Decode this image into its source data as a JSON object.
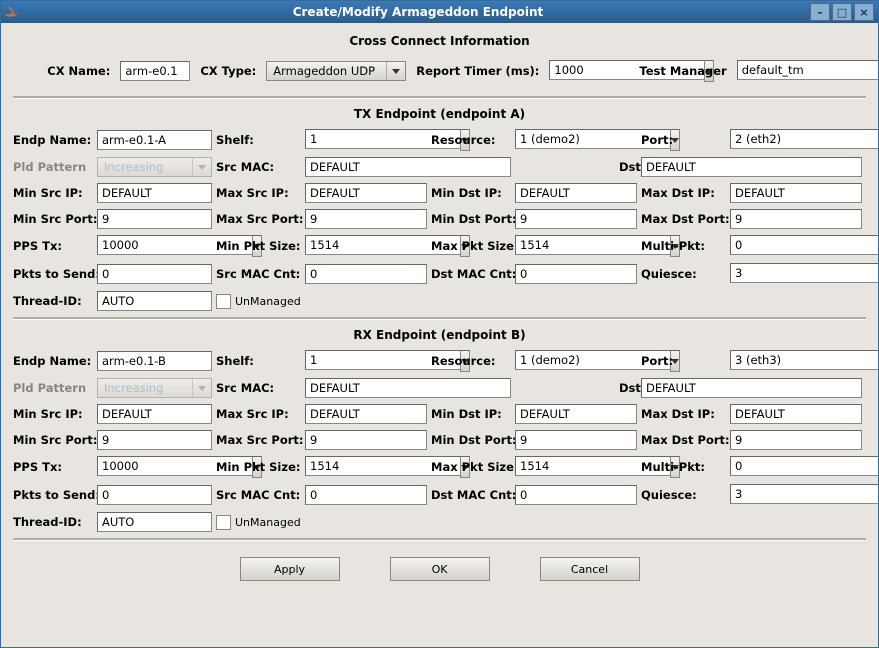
{
  "titlebar": {
    "title": "Create/Modify Armageddon Endpoint"
  },
  "sections": {
    "cross_connect_heading": "Cross Connect Information",
    "tx_heading": "TX Endpoint (endpoint A)",
    "rx_heading": "RX Endpoint (endpoint B)"
  },
  "cross_connect": {
    "cx_name_label": "CX Name:",
    "cx_name_value": "arm-e0.1",
    "cx_type_label": "CX Type:",
    "cx_type_value": "Armageddon UDP",
    "report_timer_label": "Report Timer (ms):",
    "report_timer_value": "1000",
    "test_manager_label": "Test Manager",
    "test_manager_value": "default_tm"
  },
  "labels": {
    "endp_name": "Endp Name:",
    "shelf": "Shelf:",
    "resource": "Resource:",
    "port": "Port:",
    "pld_pattern": "Pld Pattern",
    "src_mac": "Src MAC:",
    "dst_mac": "Dst MAC:",
    "min_src_ip": "Min Src IP:",
    "max_src_ip": "Max Src IP:",
    "min_dst_ip": "Min Dst IP:",
    "max_dst_ip": "Max Dst IP:",
    "min_src_port": "Min Src Port:",
    "max_src_port": "Max Src Port:",
    "min_dst_port": "Min Dst Port:",
    "max_dst_port": "Max Dst Port:",
    "pps_tx": "PPS Tx:",
    "min_pkt_size": "Min Pkt Size:",
    "max_pkt_size": "Max Pkt Size:",
    "multi_pkt": "Multi-Pkt:",
    "pkts_to_send": "Pkts to Send:",
    "src_mac_cnt": "Src MAC Cnt:",
    "dst_mac_cnt": "Dst MAC Cnt:",
    "quiesce": "Quiesce:",
    "thread_id": "Thread-ID:",
    "unmanaged": "UnManaged"
  },
  "tx": {
    "endp_name": "arm-e0.1-A",
    "shelf": "1",
    "resource": "1 (demo2)",
    "port": "2 (eth2)",
    "pld_pattern": "Increasing",
    "src_mac": "DEFAULT",
    "dst_mac": "DEFAULT",
    "min_src_ip": "DEFAULT",
    "max_src_ip": "DEFAULT",
    "min_dst_ip": "DEFAULT",
    "max_dst_ip": "DEFAULT",
    "min_src_port": "9",
    "max_src_port": "9",
    "min_dst_port": "9",
    "max_dst_port": "9",
    "pps_tx": "10000",
    "min_pkt_size": "1514",
    "max_pkt_size": "1514",
    "multi_pkt": "0",
    "pkts_to_send": "0",
    "src_mac_cnt": "0",
    "dst_mac_cnt": "0",
    "quiesce": "3",
    "thread_id": "AUTO"
  },
  "rx": {
    "endp_name": "arm-e0.1-B",
    "shelf": "1",
    "resource": "1 (demo2)",
    "port": "3 (eth3)",
    "pld_pattern": "Increasing",
    "src_mac": "DEFAULT",
    "dst_mac": "DEFAULT",
    "min_src_ip": "DEFAULT",
    "max_src_ip": "DEFAULT",
    "min_dst_ip": "DEFAULT",
    "max_dst_ip": "DEFAULT",
    "min_src_port": "9",
    "max_src_port": "9",
    "min_dst_port": "9",
    "max_dst_port": "9",
    "pps_tx": "10000",
    "min_pkt_size": "1514",
    "max_pkt_size": "1514",
    "multi_pkt": "0",
    "pkts_to_send": "0",
    "src_mac_cnt": "0",
    "dst_mac_cnt": "0",
    "quiesce": "3",
    "thread_id": "AUTO"
  },
  "buttons": {
    "apply": "Apply",
    "ok": "OK",
    "cancel": "Cancel"
  }
}
